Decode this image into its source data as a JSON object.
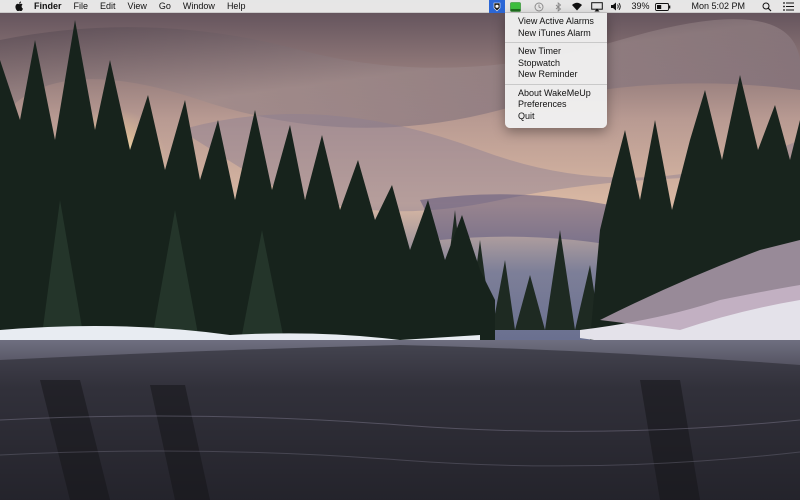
{
  "menubar": {
    "app_name": "Finder",
    "menus": [
      "File",
      "Edit",
      "View",
      "Go",
      "Window",
      "Help"
    ],
    "battery_percent": "39%",
    "clock": "Mon 5:02 PM",
    "status_icons": [
      "wakemeup-icon",
      "green-app-icon",
      "time-machine-icon",
      "bluetooth-icon",
      "wifi-icon",
      "airplay-icon",
      "volume-icon",
      "battery-icon",
      "spotlight-icon",
      "notification-center-icon"
    ]
  },
  "dropdown": {
    "group1": [
      "View Active Alarms",
      "New iTunes Alarm"
    ],
    "group2": [
      "New Timer",
      "Stopwatch",
      "New Reminder"
    ],
    "group3": [
      "About WakeMeUp",
      "Preferences",
      "Quit"
    ]
  },
  "colors": {
    "highlight": "#2c67d6",
    "menubar": "#ececec",
    "green_icon": "#3fbf3f"
  }
}
